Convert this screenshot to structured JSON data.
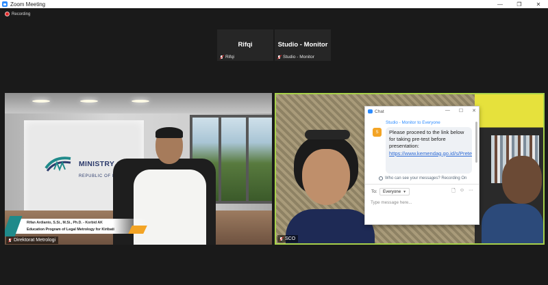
{
  "window": {
    "title": "Zoom Meeting",
    "controls": {
      "minimize": "—",
      "maximize": "❐",
      "close": "✕"
    }
  },
  "recording": {
    "label": "Recording"
  },
  "thumbnails": [
    {
      "big_name": "Rifqi",
      "label": "Rifqi"
    },
    {
      "big_name": "Studio - Monitor",
      "label": "Studio - Monitor"
    }
  ],
  "tiles": {
    "left": {
      "label": "Direktorat Metrologi",
      "logo_line1": "MINISTRY OF TRADE",
      "logo_line2": "REPUBLIC OF INDONESIA",
      "banner_name": "Rifan Ardianto, S.Si., M.Si., Ph.D. - Korbid AK",
      "banner_title": "Education Program of Legal Metrology for Kiribati"
    },
    "right": {
      "label": "SCO"
    }
  },
  "chat": {
    "title": "Chat",
    "buttons": {
      "minimize": "—",
      "maximize": "☐",
      "close": "✕"
    },
    "from": "Studio - Monitor to Everyone",
    "avatar": "S",
    "message_text": "Please proceed to the link below for taking pre-test before presentation:",
    "message_link": "https://www.kemendag.go.id/s/Pretest",
    "privacy": "Who can see your messages? Recording On",
    "to_label": "To:",
    "recipient": "Everyone",
    "input_placeholder": "Type message here...",
    "tools": {
      "file": "🗋",
      "emoji": "☺",
      "more": "···"
    }
  },
  "colors": {
    "zoom_blue": "#2d8cff",
    "active_speaker_border": "#a8d24a",
    "recording_red": "#e02828"
  }
}
